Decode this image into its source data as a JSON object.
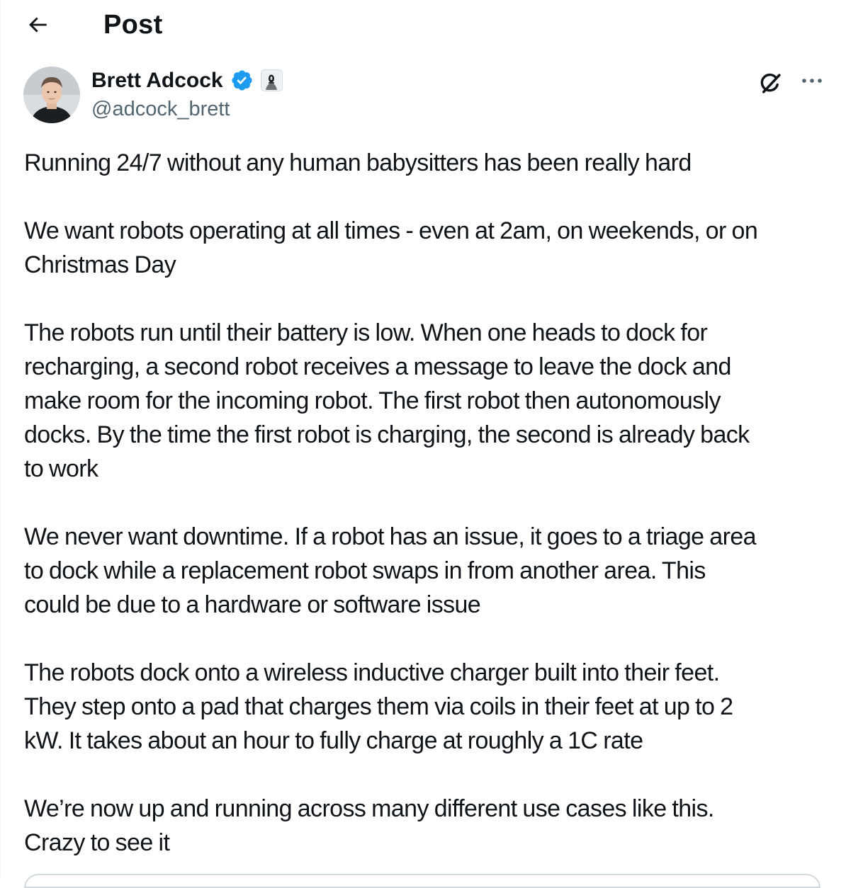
{
  "header": {
    "back_icon": "arrow-left-icon",
    "title": "Post"
  },
  "author": {
    "name": "Brett Adcock",
    "handle": "@adcock_brett",
    "verified_icon": "verified-badge-icon",
    "verified_color": "#1d9bf0",
    "affiliate_icon": "affiliate-badge-icon",
    "avatar_icon": "avatar"
  },
  "actions": {
    "grok_icon": "grok-icon",
    "more_icon": "more-horizontal-icon"
  },
  "tweet": {
    "paragraphs": [
      [
        "Running 24/7 without any human babysitters has been really hard"
      ],
      [
        "We want robots operating at all times - even at 2am, on weekends, or on",
        "Christmas Day"
      ],
      [
        "The robots run until their battery is low. When one heads to dock for",
        "recharging, a second robot receives a message to leave the dock and",
        "make room for the incoming robot. The first robot then autonomously",
        "docks. By the time the first robot is charging, the second is already back",
        "to work"
      ],
      [
        "We never want downtime. If a robot has an issue, it goes to a triage area",
        "to dock while a replacement robot swaps in from another area. This",
        "could be due to a hardware or software issue"
      ],
      [
        "The robots dock onto a wireless inductive charger built into their feet.",
        "They step onto a pad that charges them via coils in their feet at up to 2",
        "kW. It takes about an hour to fully charge at roughly a 1C rate"
      ],
      [
        "We’re now up and running across many different use cases like this.",
        "Crazy to see it"
      ]
    ]
  },
  "colors": {
    "text": "#0f1419",
    "secondary": "#536471",
    "accent": "#1d9bf0",
    "border": "#cfd9de"
  }
}
